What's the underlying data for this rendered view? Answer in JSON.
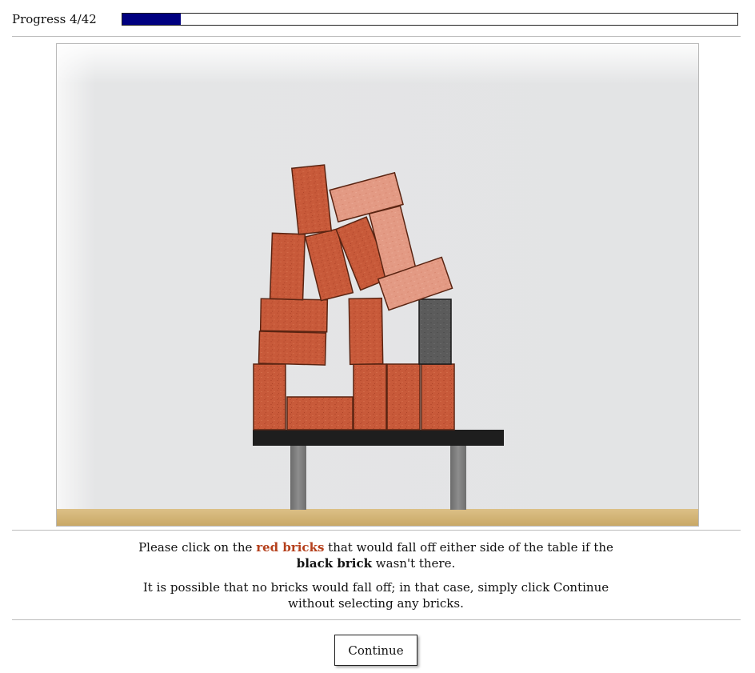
{
  "progress": {
    "label": "Progress 4/42",
    "current": 4,
    "total": 42
  },
  "instructions": {
    "line1_pre": "Please click on the ",
    "line1_red": "red bricks",
    "line1_mid": " that would fall off either side of the table if the ",
    "line1_black": "black brick",
    "line1_post": " wasn't there.",
    "line2": "It is possible that no bricks would fall off; in that case, simply click Continue without selecting any bricks."
  },
  "continue_label": "Continue",
  "colors": {
    "progress_fill": "#000080",
    "red_brick": "#c85a3a",
    "light_brick": "#e39a84",
    "black_brick": "#5a5a5a",
    "table_top": "#1e1e1e",
    "table_leg": "#7d7d7d",
    "floor": "#d6b97a",
    "wall": "#e4e5e6",
    "highlight_text": "#b5401c"
  }
}
